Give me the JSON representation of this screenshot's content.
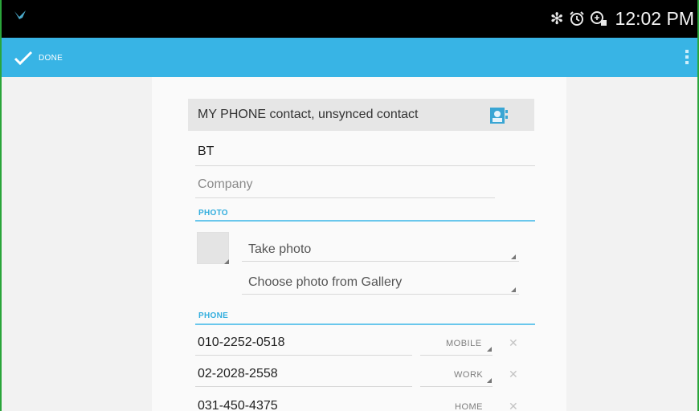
{
  "status_bar": {
    "time": "12:02 PM",
    "icons": [
      "app-notification-icon",
      "bluetooth-icon",
      "alarm-icon",
      "sync-icon"
    ]
  },
  "action_bar": {
    "done_label": "DONE",
    "accent_color": "#38b4e5"
  },
  "account": {
    "header_text": "MY PHONE contact, unsynced contact"
  },
  "name": {
    "value": "BT"
  },
  "company": {
    "placeholder": "Company"
  },
  "photo": {
    "section_title": "PHOTO",
    "options": [
      {
        "label": "Take photo"
      },
      {
        "label": "Choose photo from Gallery"
      }
    ]
  },
  "phone": {
    "section_title": "PHONE",
    "entries": [
      {
        "number": "010-2252-0518",
        "type": "MOBILE"
      },
      {
        "number": "02-2028-2558",
        "type": "WORK"
      },
      {
        "number": "031-450-4375",
        "type": "HOME"
      }
    ]
  }
}
